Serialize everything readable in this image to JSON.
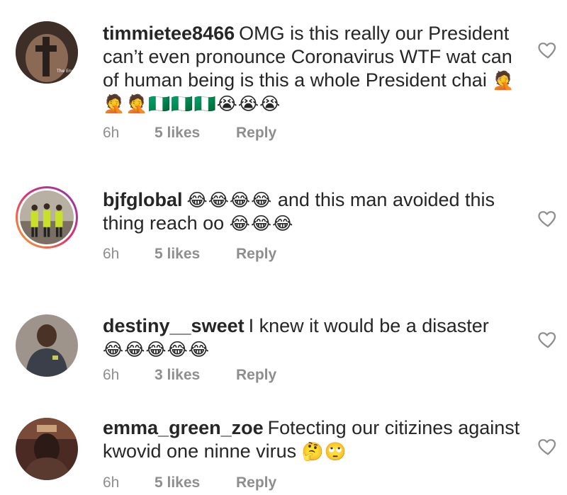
{
  "comments": [
    {
      "username": "timmietee8466",
      "text": "OMG is this really our President can’t even pronounce Coronavirus WTF wat can of human being is this a whole President chai",
      "emoji": "🤦🤦🤦🇳🇬🇳🇬🇳🇬😭😭😭",
      "time": "6h",
      "likes": "5 likes",
      "reply": "Reply"
    },
    {
      "username": "bjfglobal",
      "emoji_lead": "😂😂😂😂",
      "text": "and this man avoided this thing reach oo",
      "emoji": "😂😂😂",
      "time": "6h",
      "likes": "5 likes",
      "reply": "Reply"
    },
    {
      "username": "destiny__sweet",
      "text": "I knew it would be a disaster",
      "emoji": "😂😂😂😂😂",
      "time": "6h",
      "likes": "3 likes",
      "reply": "Reply"
    },
    {
      "username": "emma_green_zoe",
      "text": "Fotecting our citizines against kwovid one ninne virus",
      "emoji": "🤔🙄",
      "time": "6h",
      "likes": "5 likes",
      "reply": "Reply"
    }
  ],
  "icons": {
    "like": "heart-outline-icon"
  }
}
